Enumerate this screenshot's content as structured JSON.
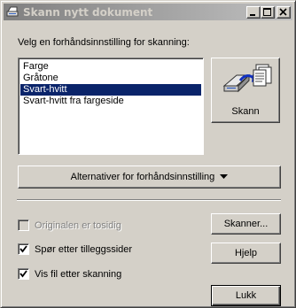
{
  "window": {
    "title": "Skann nytt dokument",
    "minimize_icon": "minimize-icon",
    "maximize_icon": "maximize-icon",
    "close_icon": "close-icon",
    "app_icon": "scanner-app-icon"
  },
  "preset": {
    "prompt": "Velg en forhåndsinnstilling for skanning:",
    "items": [
      {
        "label": "Farge",
        "selected": false
      },
      {
        "label": "Gråtone",
        "selected": false
      },
      {
        "label": "Svart-hvitt",
        "selected": true
      },
      {
        "label": "Svart-hvitt fra fargeside",
        "selected": false
      }
    ],
    "options_button": "Alternativer for forhåndsinnstilling",
    "options_arrow_icon": "triangle-down-icon"
  },
  "scan_button": {
    "label": "Skann",
    "icon": "scanner-pages-icon"
  },
  "options": {
    "duplex": {
      "label": "Originalen er tosidig",
      "checked": false,
      "enabled": false
    },
    "ask_more": {
      "label": "Spør etter tilleggssider",
      "checked": true,
      "enabled": true
    },
    "view_after": {
      "label": "Vis fil etter skanning",
      "checked": true,
      "enabled": true
    }
  },
  "buttons": {
    "scanner": "Skanner...",
    "help": "Hjelp",
    "close": "Lukk"
  }
}
